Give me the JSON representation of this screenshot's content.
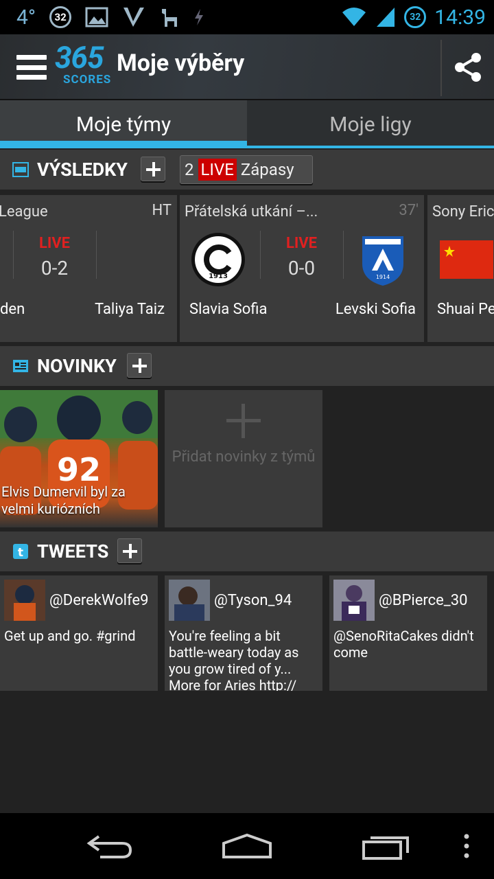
{
  "status_bar": {
    "temperature": "4°",
    "notification_badge": "32",
    "battery_badge": "32",
    "time": "14:39"
  },
  "action_bar": {
    "logo_number": "365",
    "logo_text": "SCORES",
    "title": "Moje výběry"
  },
  "tabs": [
    {
      "label": "Moje týmy",
      "active": true
    },
    {
      "label": "Moje ligy",
      "active": false
    }
  ],
  "results": {
    "title": "VÝSLEDKY",
    "live_count": "2",
    "live_label": "LIVE",
    "live_suffix": "Zápasy",
    "matches": [
      {
        "league": "League",
        "time": "HT",
        "status": "LIVE",
        "score": "0-2",
        "home": "den",
        "away": "Taliya Taiz"
      },
      {
        "league": "Přátelská utkání –...",
        "time": "37'",
        "status": "LIVE",
        "score": "0-0",
        "home": "Slavia Sofia",
        "away": "Levski Sofia",
        "home_crest_year": "1913",
        "away_crest_year": "1914"
      },
      {
        "league": "Sony Eric",
        "home": "Shuai Pe"
      }
    ]
  },
  "news": {
    "title": "NOVINKY",
    "items": [
      {
        "caption": "Elvis Dumervil byl za velmi kuriózních",
        "jersey_number": "92"
      }
    ],
    "add_text": "Přidat novinky z týmů"
  },
  "tweets": {
    "title": "TWEETS",
    "items": [
      {
        "handle": "@DerekWolfe9",
        "text": "Get up and go. #grind"
      },
      {
        "handle": "@Tyson_94",
        "text": "You're feeling a bit battle-weary today as you grow tired of y... More for Aries http://"
      },
      {
        "handle": "@BPierce_30",
        "text": "@SenoRitaCakes didn't come"
      }
    ]
  },
  "colors": {
    "accent": "#33b5e5",
    "live_red": "#e02020",
    "logo_blue": "#2aa6de"
  }
}
